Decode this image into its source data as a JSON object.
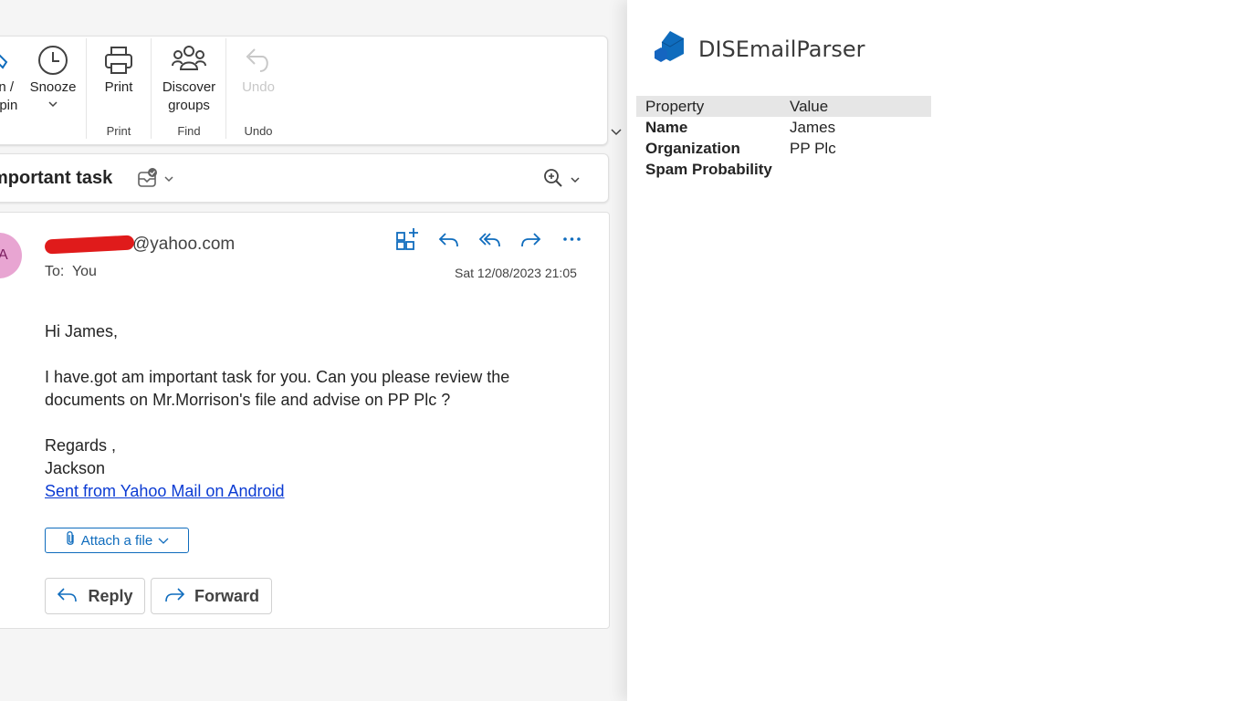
{
  "ribbon": {
    "pin_label_top": "in /",
    "pin_label_bottom": "npin",
    "snooze_label": "Snooze",
    "print_label": "Print",
    "discover_label_1": "Discover",
    "discover_label_2": "groups",
    "undo_label": "Undo",
    "groups": {
      "print": "Print",
      "find": "Find",
      "undo": "Undo"
    }
  },
  "subject": {
    "text": "mportant task"
  },
  "message": {
    "avatar_initial": "A",
    "sender_domain": "@yahoo.com",
    "to_prefix": "To:",
    "to_value": "You",
    "date": "Sat 12/08/2023 21:05",
    "greeting": "Hi James,",
    "body_line1": "I have.got am important task for you. Can you please review the",
    "body_line2": "documents on Mr.Morrison's file and advise on PP Plc ?",
    "closing": "Regards ,",
    "signature": "Jackson",
    "link_text": "Sent from Yahoo Mail on Android",
    "attach_label": "Attach a file",
    "reply_label": "Reply",
    "forward_label": "Forward"
  },
  "addin": {
    "title": "DISEmailParser",
    "table": {
      "headers": [
        "Property",
        "Value"
      ],
      "rows": [
        {
          "property": "Name",
          "value": "James"
        },
        {
          "property": "Organization",
          "value": "PP Plc"
        },
        {
          "property": "Spam Probability",
          "value": ""
        }
      ]
    }
  },
  "colors": {
    "accent": "#0f6cbd",
    "link": "#0b3bd3",
    "avatar": "#e8a5d2",
    "redaction": "#e01b1b",
    "logo": "#0f6cbd"
  }
}
